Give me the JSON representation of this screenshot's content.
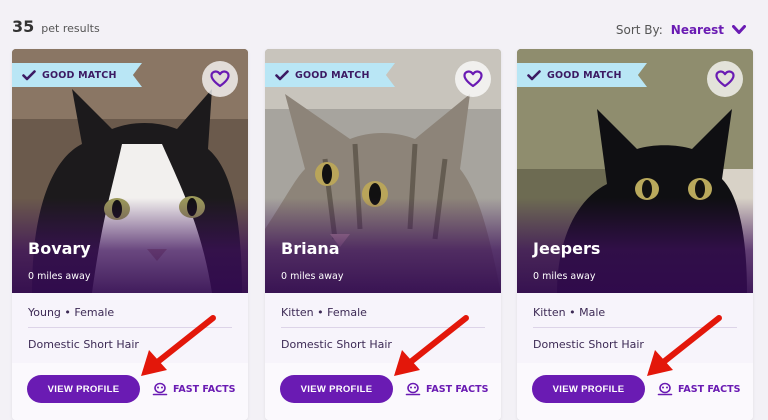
{
  "results": {
    "count": "35",
    "label": "pet results"
  },
  "sort": {
    "label": "Sort By:",
    "value": "Nearest"
  },
  "cards": [
    {
      "badge": "GOOD MATCH",
      "name": "Bovary",
      "distance": "0 miles away",
      "age_sex": "Young • Female",
      "breed": "Domestic Short Hair",
      "view_label": "VIEW PROFILE",
      "facts_label": "FAST FACTS"
    },
    {
      "badge": "GOOD MATCH",
      "name": "Briana",
      "distance": "0 miles away",
      "age_sex": "Kitten • Female",
      "breed": "Domestic Short Hair",
      "view_label": "VIEW PROFILE",
      "facts_label": "FAST FACTS"
    },
    {
      "badge": "GOOD MATCH",
      "name": "Jeepers",
      "distance": "0 miles away",
      "age_sex": "Kitten • Male",
      "breed": "Domestic Short Hair",
      "view_label": "VIEW PROFILE",
      "facts_label": "FAST FACTS"
    }
  ],
  "colors": {
    "brand": "#6a1bb3",
    "badge_bg": "#b9e6f5",
    "annotation_arrow": "#e3170a"
  }
}
